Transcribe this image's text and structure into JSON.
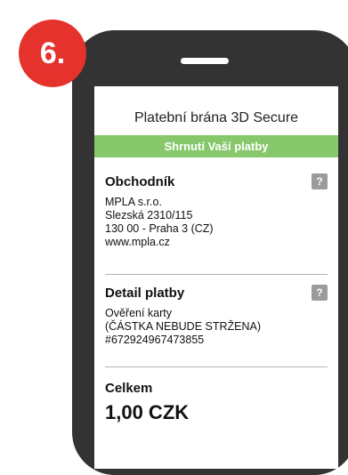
{
  "step": {
    "label": "6."
  },
  "gateway": {
    "title": "Platební brána 3D Secure"
  },
  "summary": {
    "banner": "Shrnutí Vaší platby"
  },
  "merchant": {
    "title": "Obchodník",
    "help": "?",
    "lines": [
      "MPLA s.r.o.",
      "Slezská 2310/115",
      "130 00 - Praha 3 (CZ)",
      "www.mpla.cz"
    ]
  },
  "payment_detail": {
    "title": "Detail platby",
    "help": "?",
    "lines": [
      "Ověření karty",
      "(ČÁSTKA NEBUDE STRŽENA)",
      "#672924967473855"
    ]
  },
  "total": {
    "label": "Celkem",
    "amount": "1,00 CZK"
  },
  "colors": {
    "badge": "#e5322d",
    "banner": "#86c86b",
    "phone": "#333333",
    "help": "#9b9b9b"
  }
}
